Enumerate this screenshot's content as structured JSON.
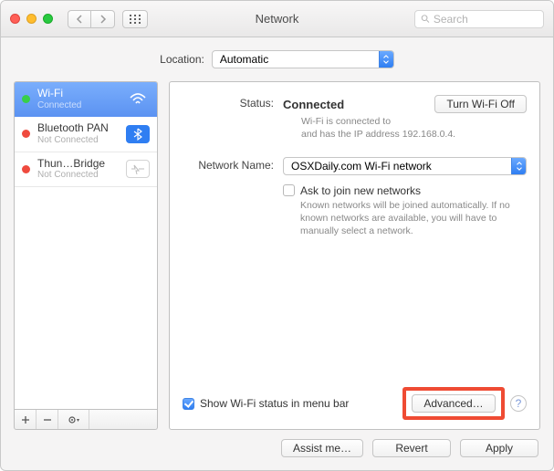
{
  "window": {
    "title": "Network"
  },
  "toolbar": {
    "search_placeholder": "Search"
  },
  "location": {
    "label": "Location:",
    "value": "Automatic"
  },
  "sidebar": {
    "items": [
      {
        "title": "Wi-Fi",
        "subtitle": "Connected",
        "status": "green",
        "badge": "wifi",
        "selected": true
      },
      {
        "title": "Bluetooth PAN",
        "subtitle": "Not Connected",
        "status": "red",
        "badge": "bluetooth",
        "selected": false
      },
      {
        "title": "Thun…Bridge",
        "subtitle": "Not Connected",
        "status": "red",
        "badge": "thunderbolt",
        "selected": false
      }
    ]
  },
  "detail": {
    "status_label": "Status:",
    "status_value": "Connected",
    "toggle_label": "Turn Wi-Fi Off",
    "status_desc": "Wi-Fi is connected to\nand has the IP address 192.168.0.4.",
    "network_name_label": "Network Name:",
    "network_name_value": "OSXDaily.com Wi-Fi network",
    "ask_join_label": "Ask to join new networks",
    "ask_join_desc": "Known networks will be joined automatically. If no known networks are available, you will have to manually select a network.",
    "show_status_label": "Show Wi-Fi status in menu bar",
    "advanced_label": "Advanced…",
    "help": "?"
  },
  "footer": {
    "assist": "Assist me…",
    "revert": "Revert",
    "apply": "Apply"
  }
}
